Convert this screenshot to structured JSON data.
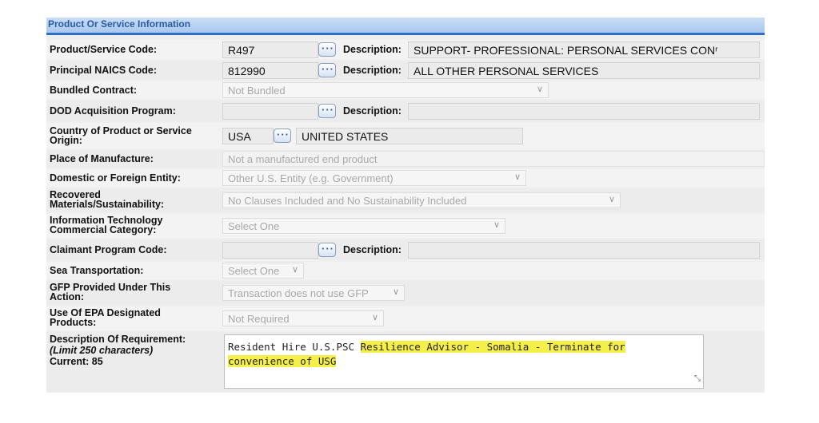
{
  "section_title": "Product Or Service Information",
  "rows": {
    "psc": {
      "label": "Product/Service Code:",
      "value": "R497",
      "desc_label": "Description:",
      "desc_value": "SUPPORT- PROFESSIONAL: PERSONAL SERVICES CONʳ"
    },
    "naics": {
      "label": "Principal NAICS Code:",
      "value": "812990",
      "desc_label": "Description:",
      "desc_value": "ALL OTHER PERSONAL SERVICES"
    },
    "bundled": {
      "label": "Bundled Contract:",
      "value": "Not Bundled"
    },
    "dod": {
      "label": "DOD Acquisition Program:",
      "value": "",
      "desc_label": "Description:",
      "desc_value": ""
    },
    "country": {
      "label": "Country of Product or Service Origin:",
      "value": "USA",
      "desc_value": "UNITED STATES"
    },
    "manufacture": {
      "label": "Place of Manufacture:",
      "value": "Not a manufactured end product"
    },
    "entity": {
      "label": "Domestic or Foreign Entity:",
      "value": "Other U.S. Entity (e.g. Government)"
    },
    "recovered": {
      "label": "Recovered Materials/Sustainability:",
      "value": "No Clauses Included and No Sustainability Included"
    },
    "it": {
      "label": "Information Technology Commercial Category:",
      "value": "Select One"
    },
    "claimant": {
      "label": "Claimant Program Code:",
      "value": "",
      "desc_label": "Description:",
      "desc_value": ""
    },
    "sea": {
      "label": "Sea Transportation:",
      "value": "Select One"
    },
    "gfp": {
      "label": "GFP Provided Under This Action:",
      "value": "Transaction does not use GFP"
    },
    "epa": {
      "label": "Use Of EPA Designated Products:",
      "value": "Not Required"
    }
  },
  "requirement": {
    "label": "Description Of Requirement:",
    "limit": "(Limit 250 characters)",
    "current": "Current: 85",
    "text_plain": "Resident Hire U.S.PSC ",
    "text_highlight_1": "Resilience Advisor - Somalia - Terminate for",
    "text_highlight_2": "convenience of USG"
  },
  "icons": {
    "lookup": "ellipsis-lookup-icon",
    "dropdown": "chevron-down-icon",
    "resize": "resize-grip-icon"
  },
  "colors": {
    "header_accent": "#2f6fc4",
    "highlight": "#f5ef4a"
  }
}
